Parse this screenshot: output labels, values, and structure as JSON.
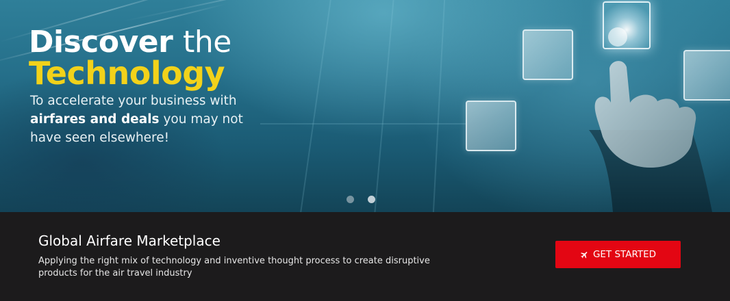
{
  "hero": {
    "heading_bold": "Discover",
    "heading_light": "the",
    "heading_highlight": "Technology",
    "subtext_prefix": "To accelerate your business with",
    "subtext_bold": "airfares and deals",
    "subtext_suffix": "you may not have seen elsewhere!",
    "carousel": {
      "slide_count": 2,
      "active_slide": 2
    }
  },
  "bar": {
    "title": "Global Airfare Marketplace",
    "description": "Applying the right mix of technology and inventive thought process to create disruptive products for the air travel industry",
    "cta_label": "GET STARTED",
    "cta_icon": "plane-icon"
  },
  "colors": {
    "accent_yellow": "#f2d21a",
    "cta_red": "#e30613",
    "bar_background": "#1c1b1c"
  }
}
